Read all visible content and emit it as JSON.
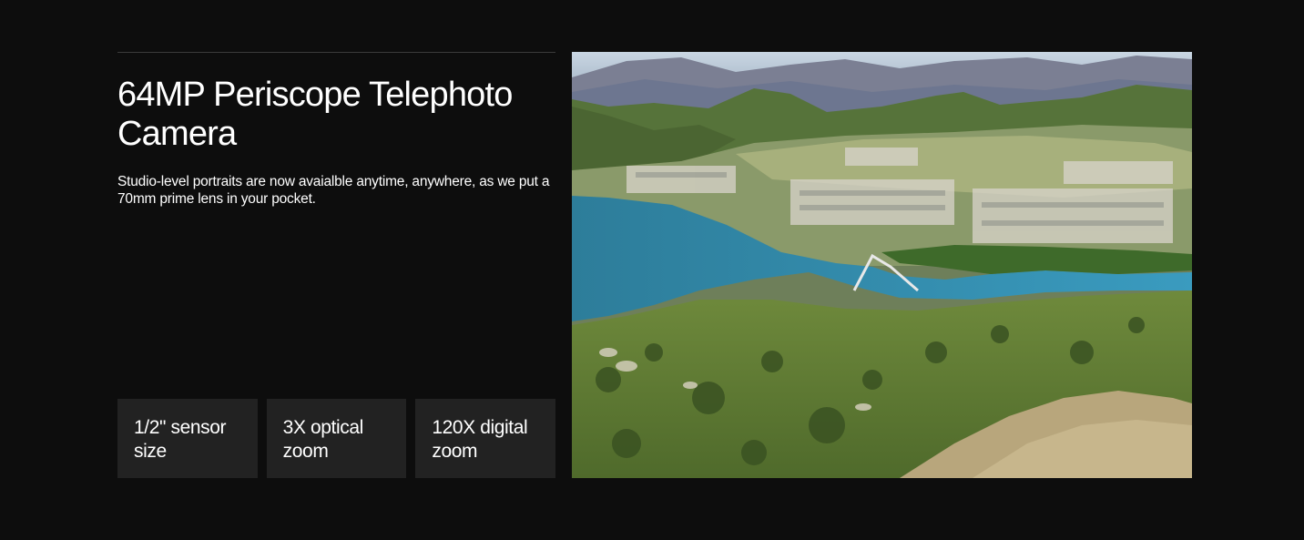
{
  "feature": {
    "title": "64MP Periscope Telephoto Camera",
    "description": "Studio-level portraits are now avaialble anytime, anywhere, as we put a 70mm prime lens in your pocket.",
    "specs": [
      {
        "label": "1/2\" sensor size"
      },
      {
        "label": "3X optical zoom"
      },
      {
        "label": "120X digital zoom"
      }
    ]
  },
  "colors": {
    "background": "#0d0d0d",
    "card": "#222222",
    "divider": "#3a3a3a",
    "text": "#ffffff"
  }
}
